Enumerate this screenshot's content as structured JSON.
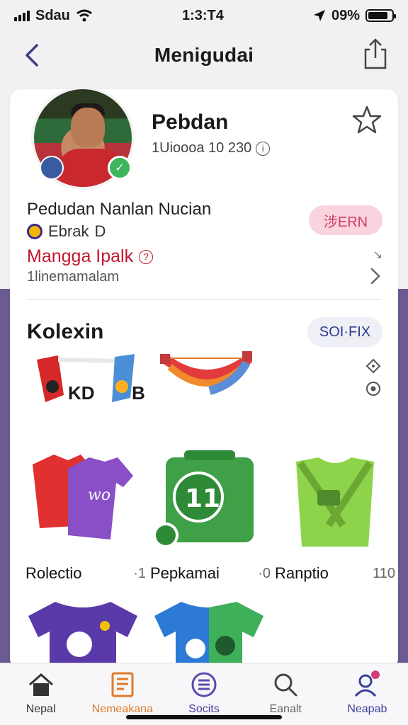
{
  "status": {
    "carrier": "Sdau",
    "time": "1:3:T4",
    "battery": "09%",
    "signal_icon": "signal-icon",
    "wifi_icon": "wifi-icon",
    "location_icon": "location-arrow-icon",
    "battery_icon": "battery-icon"
  },
  "nav": {
    "title": "Menigudai",
    "back_icon": "chevron-left-icon",
    "share_icon": "share-icon"
  },
  "profile": {
    "name": "Pebdan",
    "meta": "1Uioooa 10 230",
    "meta_icon": "info-icon",
    "favorite_icon": "star-icon",
    "section_title": "Pedudan Nanlan  Nucian",
    "sub_label": "Ebrak",
    "sub_badge": "D",
    "pill_label": "涉ERN",
    "link_label": "Mangga Ipalk",
    "muted_line": "1linemamalam"
  },
  "collection": {
    "title": "Kolexin",
    "sort_label": "SOI·FIX",
    "scarf_text_a": "KD",
    "scarf_text_b": "B",
    "items": [
      {
        "name": "Rolectio",
        "count": "·1"
      },
      {
        "name": "Pepkamai",
        "count": "·0"
      },
      {
        "name": "Ranptio",
        "count": "110"
      }
    ]
  },
  "tabs": [
    {
      "label": "Nepal",
      "icon": "home-icon"
    },
    {
      "label": "Nemeakana",
      "icon": "list-icon"
    },
    {
      "label": "Socits",
      "icon": "menu-circle-icon"
    },
    {
      "label": "Eanalt",
      "icon": "search-icon"
    },
    {
      "label": "Neapab",
      "icon": "profile-icon"
    }
  ],
  "colors": {
    "accent_purple": "#6b5b93",
    "link_red": "#c5162e",
    "pill_pink": "#f9d3dd",
    "active_tab": "#e07a2c"
  }
}
